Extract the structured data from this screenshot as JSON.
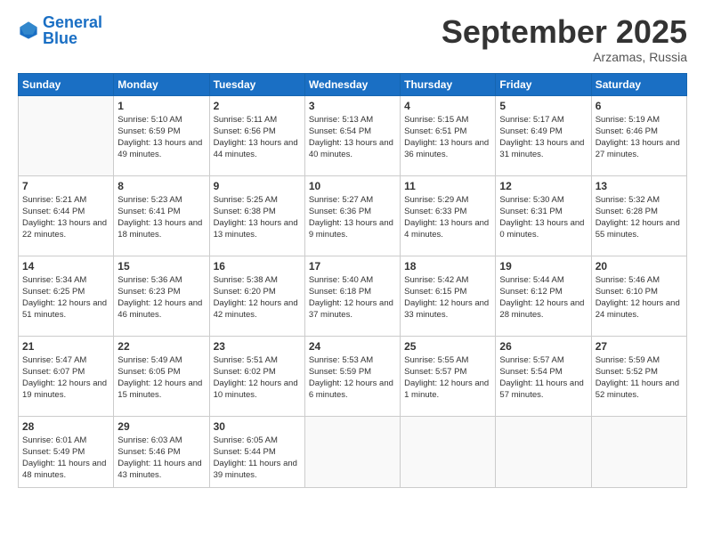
{
  "header": {
    "logo_general": "General",
    "logo_blue": "Blue",
    "month": "September 2025",
    "location": "Arzamas, Russia"
  },
  "weekdays": [
    "Sunday",
    "Monday",
    "Tuesday",
    "Wednesday",
    "Thursday",
    "Friday",
    "Saturday"
  ],
  "weeks": [
    [
      {
        "day": "",
        "empty": true
      },
      {
        "day": "1",
        "sunrise": "5:10 AM",
        "sunset": "6:59 PM",
        "daylight": "13 hours and 49 minutes."
      },
      {
        "day": "2",
        "sunrise": "5:11 AM",
        "sunset": "6:56 PM",
        "daylight": "13 hours and 44 minutes."
      },
      {
        "day": "3",
        "sunrise": "5:13 AM",
        "sunset": "6:54 PM",
        "daylight": "13 hours and 40 minutes."
      },
      {
        "day": "4",
        "sunrise": "5:15 AM",
        "sunset": "6:51 PM",
        "daylight": "13 hours and 36 minutes."
      },
      {
        "day": "5",
        "sunrise": "5:17 AM",
        "sunset": "6:49 PM",
        "daylight": "13 hours and 31 minutes."
      },
      {
        "day": "6",
        "sunrise": "5:19 AM",
        "sunset": "6:46 PM",
        "daylight": "13 hours and 27 minutes."
      }
    ],
    [
      {
        "day": "7",
        "sunrise": "5:21 AM",
        "sunset": "6:44 PM",
        "daylight": "13 hours and 22 minutes."
      },
      {
        "day": "8",
        "sunrise": "5:23 AM",
        "sunset": "6:41 PM",
        "daylight": "13 hours and 18 minutes."
      },
      {
        "day": "9",
        "sunrise": "5:25 AM",
        "sunset": "6:38 PM",
        "daylight": "13 hours and 13 minutes."
      },
      {
        "day": "10",
        "sunrise": "5:27 AM",
        "sunset": "6:36 PM",
        "daylight": "13 hours and 9 minutes."
      },
      {
        "day": "11",
        "sunrise": "5:29 AM",
        "sunset": "6:33 PM",
        "daylight": "13 hours and 4 minutes."
      },
      {
        "day": "12",
        "sunrise": "5:30 AM",
        "sunset": "6:31 PM",
        "daylight": "13 hours and 0 minutes."
      },
      {
        "day": "13",
        "sunrise": "5:32 AM",
        "sunset": "6:28 PM",
        "daylight": "12 hours and 55 minutes."
      }
    ],
    [
      {
        "day": "14",
        "sunrise": "5:34 AM",
        "sunset": "6:25 PM",
        "daylight": "12 hours and 51 minutes."
      },
      {
        "day": "15",
        "sunrise": "5:36 AM",
        "sunset": "6:23 PM",
        "daylight": "12 hours and 46 minutes."
      },
      {
        "day": "16",
        "sunrise": "5:38 AM",
        "sunset": "6:20 PM",
        "daylight": "12 hours and 42 minutes."
      },
      {
        "day": "17",
        "sunrise": "5:40 AM",
        "sunset": "6:18 PM",
        "daylight": "12 hours and 37 minutes."
      },
      {
        "day": "18",
        "sunrise": "5:42 AM",
        "sunset": "6:15 PM",
        "daylight": "12 hours and 33 minutes."
      },
      {
        "day": "19",
        "sunrise": "5:44 AM",
        "sunset": "6:12 PM",
        "daylight": "12 hours and 28 minutes."
      },
      {
        "day": "20",
        "sunrise": "5:46 AM",
        "sunset": "6:10 PM",
        "daylight": "12 hours and 24 minutes."
      }
    ],
    [
      {
        "day": "21",
        "sunrise": "5:47 AM",
        "sunset": "6:07 PM",
        "daylight": "12 hours and 19 minutes."
      },
      {
        "day": "22",
        "sunrise": "5:49 AM",
        "sunset": "6:05 PM",
        "daylight": "12 hours and 15 minutes."
      },
      {
        "day": "23",
        "sunrise": "5:51 AM",
        "sunset": "6:02 PM",
        "daylight": "12 hours and 10 minutes."
      },
      {
        "day": "24",
        "sunrise": "5:53 AM",
        "sunset": "5:59 PM",
        "daylight": "12 hours and 6 minutes."
      },
      {
        "day": "25",
        "sunrise": "5:55 AM",
        "sunset": "5:57 PM",
        "daylight": "12 hours and 1 minute."
      },
      {
        "day": "26",
        "sunrise": "5:57 AM",
        "sunset": "5:54 PM",
        "daylight": "11 hours and 57 minutes."
      },
      {
        "day": "27",
        "sunrise": "5:59 AM",
        "sunset": "5:52 PM",
        "daylight": "11 hours and 52 minutes."
      }
    ],
    [
      {
        "day": "28",
        "sunrise": "6:01 AM",
        "sunset": "5:49 PM",
        "daylight": "11 hours and 48 minutes."
      },
      {
        "day": "29",
        "sunrise": "6:03 AM",
        "sunset": "5:46 PM",
        "daylight": "11 hours and 43 minutes."
      },
      {
        "day": "30",
        "sunrise": "6:05 AM",
        "sunset": "5:44 PM",
        "daylight": "11 hours and 39 minutes."
      },
      {
        "day": "",
        "empty": true
      },
      {
        "day": "",
        "empty": true
      },
      {
        "day": "",
        "empty": true
      },
      {
        "day": "",
        "empty": true
      }
    ]
  ]
}
